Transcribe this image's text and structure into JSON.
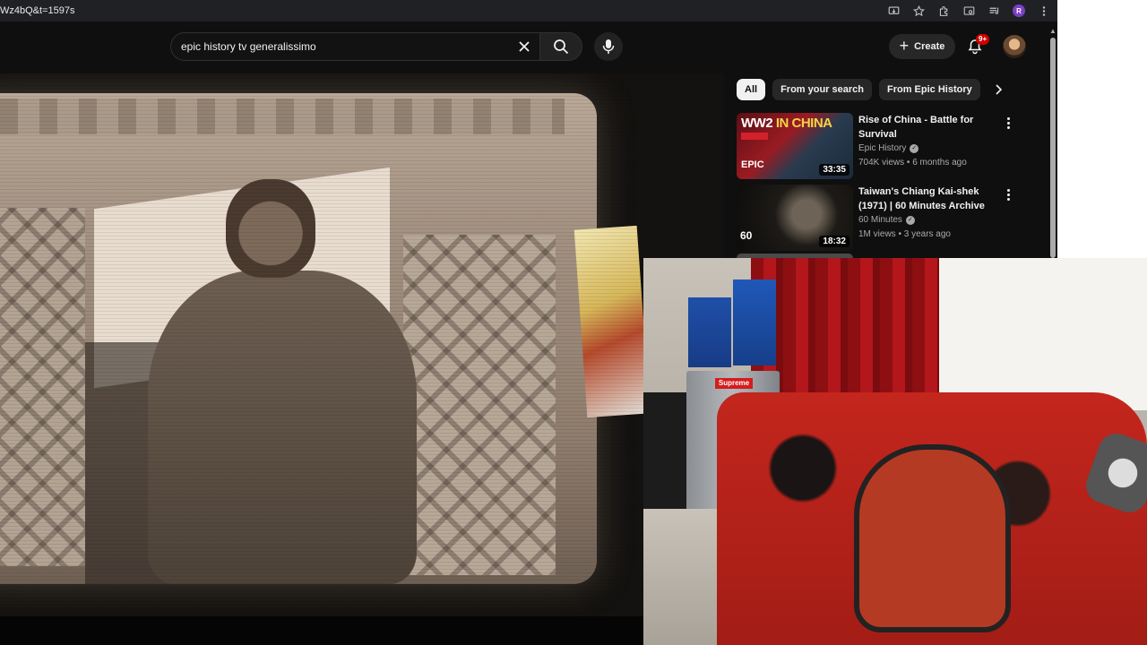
{
  "browser": {
    "url": "Wz4bQ&t=1597s"
  },
  "masthead": {
    "search_value": "epic history tv generalissimo",
    "create_label": "Create",
    "notifications_badge": "9+"
  },
  "chips": [
    {
      "label": "All",
      "active": true
    },
    {
      "label": "From your search",
      "active": false
    },
    {
      "label": "From Epic History",
      "active": false
    }
  ],
  "recommendations": [
    {
      "title": "Rise of China - Battle for Survival",
      "channel": "Epic History",
      "verified": true,
      "meta": "704K views • 6 months ago",
      "duration": "33:35",
      "thumb_title_a": "WW2 ",
      "thumb_title_b": "IN CHINA",
      "thumb_logo": "EPIC"
    },
    {
      "title": "Taiwan's Chiang Kai-shek (1971) | 60 Minutes Archive",
      "channel": "60 Minutes",
      "verified": true,
      "meta": "1M views • 3 years ago",
      "duration": "18:32",
      "thumb_logo": "60"
    }
  ],
  "webcam": {
    "fridge_label": "Supreme"
  },
  "colors": {
    "background": "#0f0f0f",
    "chip": "#272727",
    "badge": "#cc0000",
    "text_secondary": "#aaaaaa"
  }
}
